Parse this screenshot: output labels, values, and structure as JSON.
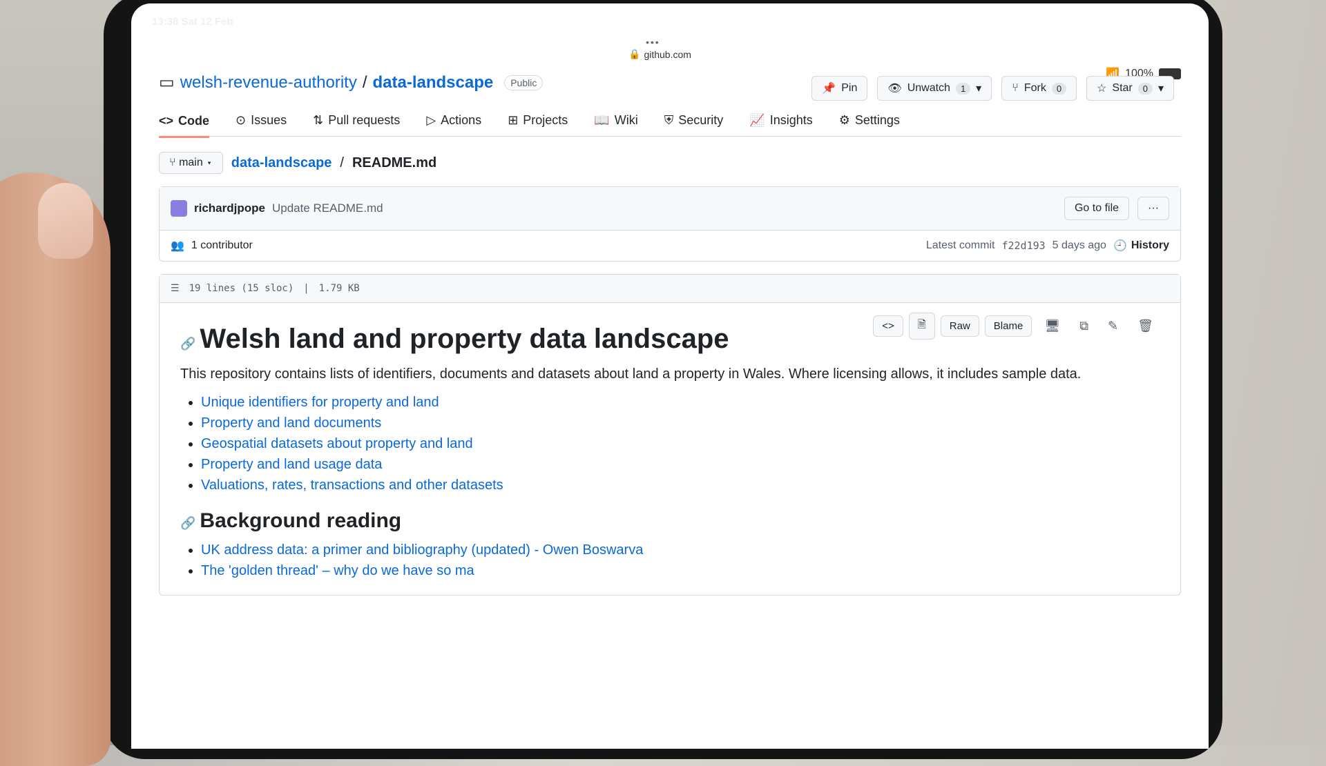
{
  "status": {
    "time": "13:38",
    "date": "Sat 12 Feb",
    "battery": "100%"
  },
  "browser": {
    "url": "github.com"
  },
  "repo": {
    "owner": "welsh-revenue-authority",
    "separator": "/",
    "name": "data-landscape",
    "visibility": "Public"
  },
  "actions": {
    "pin": "Pin",
    "unwatch": "Unwatch",
    "unwatch_count": "1",
    "fork": "Fork",
    "fork_count": "0",
    "star": "Star",
    "star_count": "0"
  },
  "tabs": [
    "Code",
    "Issues",
    "Pull requests",
    "Actions",
    "Projects",
    "Wiki",
    "Security",
    "Insights",
    "Settings"
  ],
  "branch": "main",
  "breadcrumb": {
    "root": "data-landscape",
    "sep": "/",
    "file": "README.md"
  },
  "commit": {
    "author": "richardjpope",
    "message": "Update README.md",
    "go_to_file": "Go to file",
    "more": "···",
    "contributors": "1 contributor",
    "latest_label": "Latest commit",
    "sha": "f22d193",
    "age": "5 days ago",
    "history": "History"
  },
  "file": {
    "lines": "19 lines (15 sloc)",
    "size": "1.79 KB",
    "raw": "Raw",
    "blame": "Blame"
  },
  "readme": {
    "title": "Welsh land and property data landscape",
    "intro": "This repository contains lists of identifiers, documents and datasets about land a property in Wales. Where licensing allows, it includes sample data.",
    "links": [
      "Unique identifiers for property and land",
      "Property and land documents",
      "Geospatial datasets about property and land",
      "Property and land usage data",
      "Valuations, rates, transactions and other datasets"
    ],
    "background_title": "Background reading",
    "background_links": [
      "UK address data: a primer and bibliography (updated) - Owen Boswarva",
      "The 'golden thread' – why do we have so ma"
    ]
  }
}
